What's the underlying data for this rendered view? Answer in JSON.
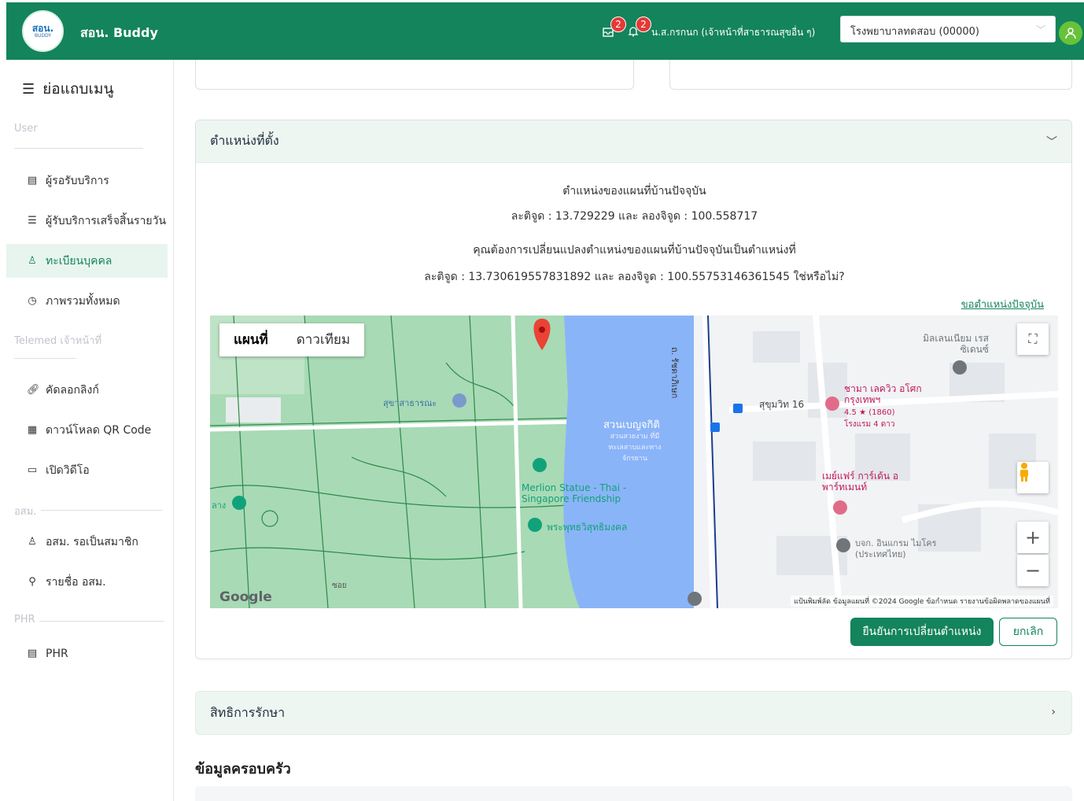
{
  "header": {
    "logo_text": "สอน.",
    "logo_sub": "BUDDY",
    "app_name": "สอน. Buddy",
    "notif1_count": "2",
    "notif2_count": "2",
    "user_name": "น.ส.กรกนก (เจ้าหน้าที่สาธารณสุขอื่น ๆ)",
    "hospital": "โรงพยาบาลทดสอบ (00000)"
  },
  "sidebar": {
    "collapse_label": "ย่อแถบเมนู",
    "group_user": "User",
    "items_user": [
      {
        "label": "ผู้รอรับบริการ",
        "icon": "file-icon"
      },
      {
        "label": "ผู้รับบริการเสร็จสิ้นรายวัน",
        "icon": "list-icon"
      },
      {
        "label": "ทะเบียนบุคคล",
        "icon": "people-icon"
      },
      {
        "label": "ภาพรวมทั้งหมด",
        "icon": "dashboard-icon"
      }
    ],
    "group_telemed": "Telemed เจ้าหน้าที่",
    "items_telemed": [
      {
        "label": "คัดลอกลิงก์",
        "icon": "link-icon"
      },
      {
        "label": "ดาวน์โหลด QR Code",
        "icon": "qr-icon"
      },
      {
        "label": "เปิดวิดีโอ",
        "icon": "video-icon"
      }
    ],
    "group_osm": "อสม.",
    "items_osm": [
      {
        "label": "อสม. รอเป็นสมาชิก",
        "icon": "user-icon"
      },
      {
        "label": "รายชื่อ อสม.",
        "icon": "list-link-icon"
      }
    ],
    "group_phr": "PHR",
    "items_phr": [
      {
        "label": "PHR",
        "icon": "record-icon"
      }
    ]
  },
  "location_panel": {
    "title": "ตำแหน่งที่ตั้ง",
    "current_title": "ตำแหน่งของแผนที่บ้านปัจจุบัน",
    "current_coords": "ละติจูด : 13.729229 และ ลองจิจูด : 100.558717",
    "question": "คุณต้องการเปลี่ยนแปลงตำแหน่งของแผนที่บ้านปัจจุบันเป็นตำแหน่งที่",
    "new_coords": "ละติจูด : 13.730619557831892 และ ลองจิจูด : 100.55753146361545 ใช่หรือไม่?",
    "current_link": "ขอตำแหน่งปัจจุบัน",
    "map": {
      "type_map": "แผนที่",
      "type_satellite": "ดาวเทียม",
      "label_lake": "สวนเบญจกิติ",
      "label_lake_sub": "สวนสวยงาม ที่มีทะเลสาบและทางจักรยาน",
      "label_merlion": "Merlion Statue - Thai - Singapore Friendship",
      "label_temple": "พระพุทธวิสุทธิมงคล",
      "label_restroom": "สุขาสาธารณะ",
      "label_road1": "ถ. รัชดาภิเษก",
      "label_road2": "สุขุมวิท 16",
      "label_hotel": "ชามา เลควิว อโศก กรุงเทพฯ",
      "label_hotel_rating": "4.5 ★ (1860)",
      "label_hotel_class": "โรงแรม 4 ดาว",
      "label_hotel2": "เมย์แฟร์ การ์เด้น อพาร์ทเมนท์",
      "label_millennium": "มิลเลนเนียม เรสซิเดนซ์",
      "label_school": "บจก. อินแกรม ไมโคร (ประเทศไทย)",
      "label_soi": "ซอย",
      "label_left": "ลาง",
      "google": "Google",
      "footer": "แป้นพิมพ์ลัด   ข้อมูลแผนที่ ©2024 Google   ข้อกำหนด   รายงานข้อผิดพลาดของแผนที่"
    },
    "confirm_button": "ยืนยันการเปลี่ยนตำแหน่ง",
    "cancel_button": "ยกเลิก"
  },
  "rights_panel": {
    "title": "สิทธิการรักษา"
  },
  "family_title": "ข้อมูลครอบครัว",
  "colors": {
    "primary": "#14845c",
    "badge": "#e53935",
    "lake": "#8ab4f8",
    "park": "#a8dab5"
  }
}
